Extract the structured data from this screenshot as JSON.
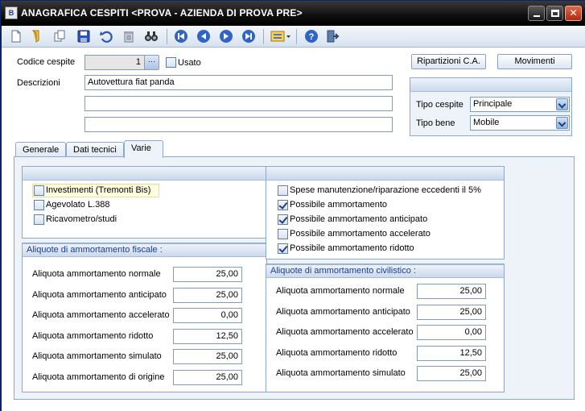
{
  "window": {
    "title": "ANAGRAFICA CESPITI <PROVA - AZIENDA DI PROVA PRE>",
    "app_icon_text": "B"
  },
  "header": {
    "codice_label": "Codice cespite",
    "codice_value": "1",
    "lookup_label": "···",
    "usato_label": "Usato",
    "descrizioni_label": "Descrizioni",
    "descrizione_1": "Autovettura fiat panda",
    "descrizione_2": "",
    "descrizione_3": "",
    "ripartizioni_button": "Ripartizioni C.A.",
    "movimenti_button": "Movimenti",
    "tipo_cespite_label": "Tipo cespite",
    "tipo_cespite_value": "Principale",
    "tipo_bene_label": "Tipo bene",
    "tipo_bene_value": "Mobile"
  },
  "tabs": [
    {
      "label": "Generale"
    },
    {
      "label": "Dati tecnici"
    },
    {
      "label": "Varie"
    }
  ],
  "left_checks": [
    {
      "label": "Investimenti (Tremonti Bis)",
      "checked": false
    },
    {
      "label": "Agevolato L.388",
      "checked": false
    },
    {
      "label": "Ricavometro/studi",
      "checked": false
    }
  ],
  "right_checks": [
    {
      "label": "Spese manutenzione/riparazione eccedenti il 5%",
      "checked": false
    },
    {
      "label": "Possibile ammortamento",
      "checked": true
    },
    {
      "label": "Possibile ammortamento anticipato",
      "checked": true
    },
    {
      "label": "Possibile ammortamento accelerato",
      "checked": false
    },
    {
      "label": "Possibile ammortamento ridotto",
      "checked": true
    }
  ],
  "fiscale": {
    "title": "Aliquote di ammortamento fiscale :",
    "rows": [
      {
        "label": "Aliquota ammortamento normale",
        "value": "25,00"
      },
      {
        "label": "Aliquota ammortamento anticipato",
        "value": "25,00"
      },
      {
        "label": "Aliquota ammortamento accelerato",
        "value": "0,00"
      },
      {
        "label": "Aliquota ammortamento ridotto",
        "value": "12,50"
      },
      {
        "label": "Aliquota ammortamento simulato",
        "value": "25,00"
      },
      {
        "label": "Aliquota ammortamento di origine",
        "value": "25,00"
      }
    ]
  },
  "civilistico": {
    "title": "Aliquote di ammortamento civilistico :",
    "rows": [
      {
        "label": "Aliquota ammortamento normale",
        "value": "25,00"
      },
      {
        "label": "Aliquota ammortamento anticipato",
        "value": "25,00"
      },
      {
        "label": "Aliquota ammortamento accelerato",
        "value": "0,00"
      },
      {
        "label": "Aliquota ammortamento ridotto",
        "value": "12,50"
      },
      {
        "label": "Aliquota ammortamento simulato",
        "value": "25,00"
      }
    ]
  },
  "toolbar_icons": [
    "new-document-icon",
    "open-folder-icon",
    "copy-icon",
    "save-icon",
    "undo-icon",
    "delete-icon",
    "find-icon",
    "first-record-icon",
    "previous-record-icon",
    "next-record-icon",
    "last-record-icon",
    "list-options-icon",
    "help-icon",
    "exit-icon"
  ],
  "colors": {
    "title_bar": "#000000",
    "accent_blue": "#1b3f8f",
    "panel_bg": "#eef3fa",
    "highlight": "#fffde0"
  }
}
